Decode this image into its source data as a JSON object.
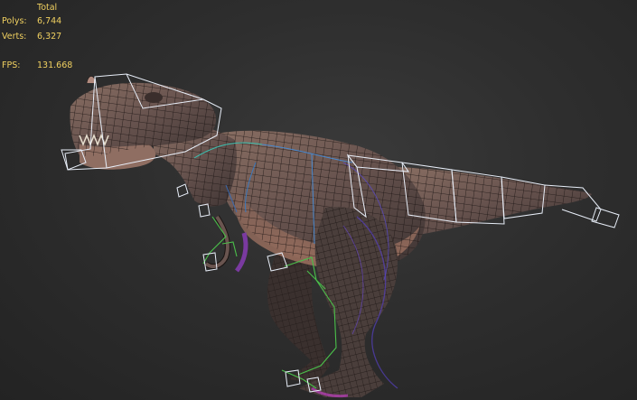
{
  "viewport": {
    "stats": {
      "header": "Total",
      "polys_label": "Polys:",
      "polys_value": "6,744",
      "verts_label": "Verts:",
      "verts_value": "6,327",
      "fps_label": "FPS:",
      "fps_value": "131.668",
      "text_color": "#f0d060"
    },
    "model": {
      "subject": "t-rex-dinosaur",
      "display_mode": "wireframe-on-shaded",
      "bone_box_color": "#e8eef8",
      "wire_color": "#1a1412"
    }
  }
}
